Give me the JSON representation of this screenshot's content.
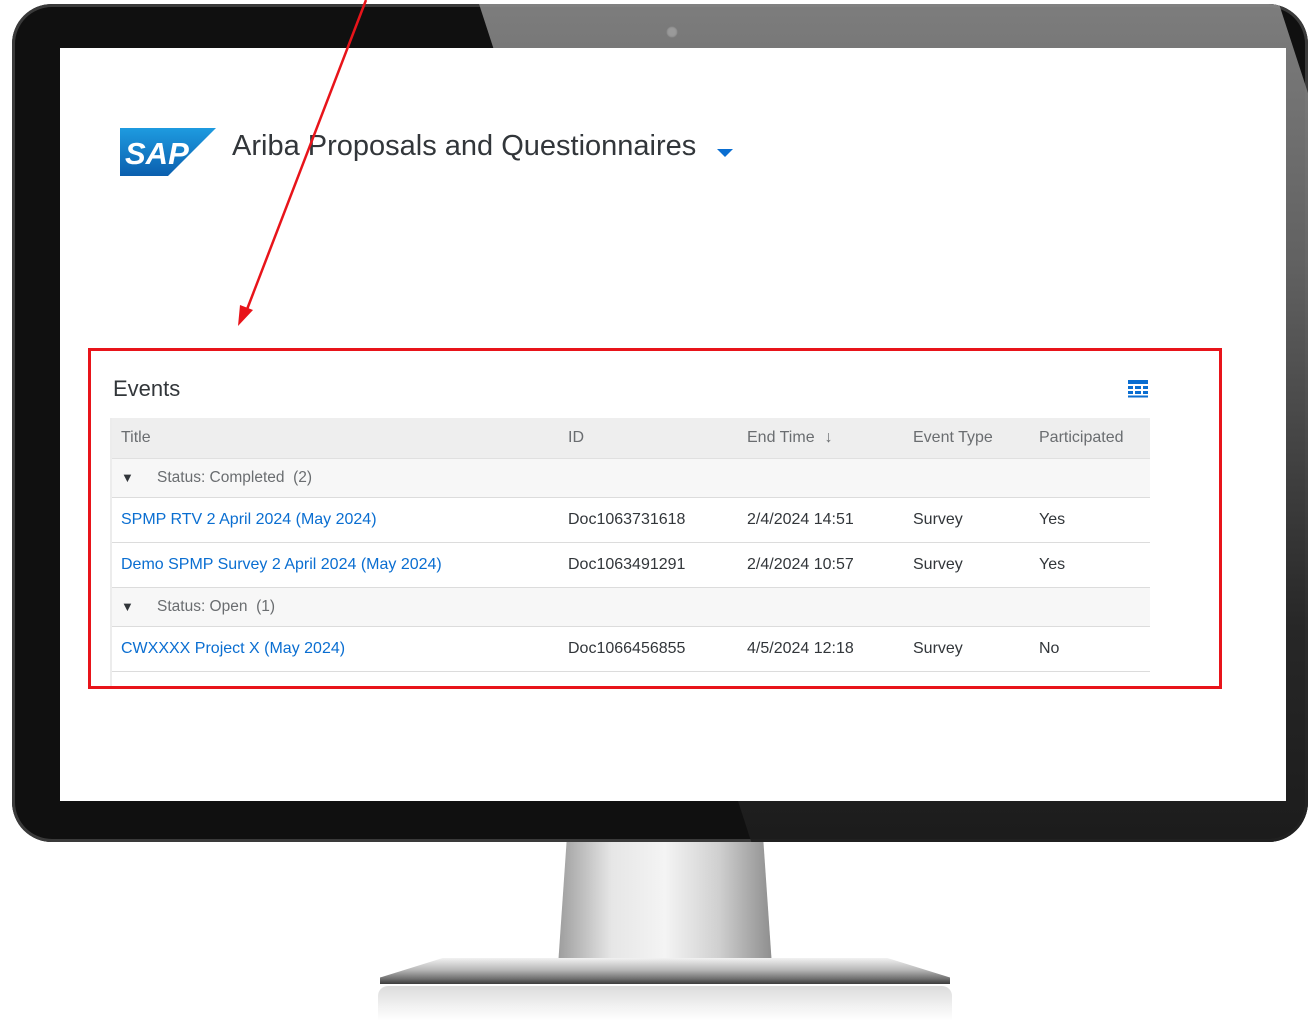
{
  "header": {
    "logo_text": "SAP",
    "app_title": "Ariba Proposals and Questionnaires",
    "dropdown_icon": "caret-down-icon"
  },
  "events": {
    "heading": "Events",
    "settings_icon": "table-settings-icon",
    "columns": {
      "title": "Title",
      "id": "ID",
      "end_time": "End Time",
      "end_time_sort": "↓",
      "event_type": "Event Type",
      "participated": "Participated"
    },
    "groups": [
      {
        "toggle": "▼",
        "label": "Status: Completed",
        "count": "(2)",
        "rows": [
          {
            "title": "SPMP RTV 2 April 2024 (May 2024)",
            "id": "Doc1063731618",
            "end_time": "2/4/2024 14:51",
            "event_type": "Survey",
            "participated": "Yes"
          },
          {
            "title": "Demo SPMP Survey 2 April 2024 (May 2024)",
            "id": "Doc1063491291",
            "end_time": "2/4/2024 10:57",
            "event_type": "Survey",
            "participated": "Yes"
          }
        ]
      },
      {
        "toggle": "▼",
        "label": "Status: Open",
        "count": "(1)",
        "rows": [
          {
            "title": "CWXXXX Project X (May 2024)",
            "id": "Doc1066456855",
            "end_time": "4/5/2024 12:18",
            "event_type": "Survey",
            "participated": "No"
          }
        ]
      }
    ]
  },
  "colors": {
    "link": "#0a6ed1",
    "sap_blue": "#0f6fbf",
    "annotation_red": "#e8141a",
    "header_bg": "#eeeeee"
  }
}
